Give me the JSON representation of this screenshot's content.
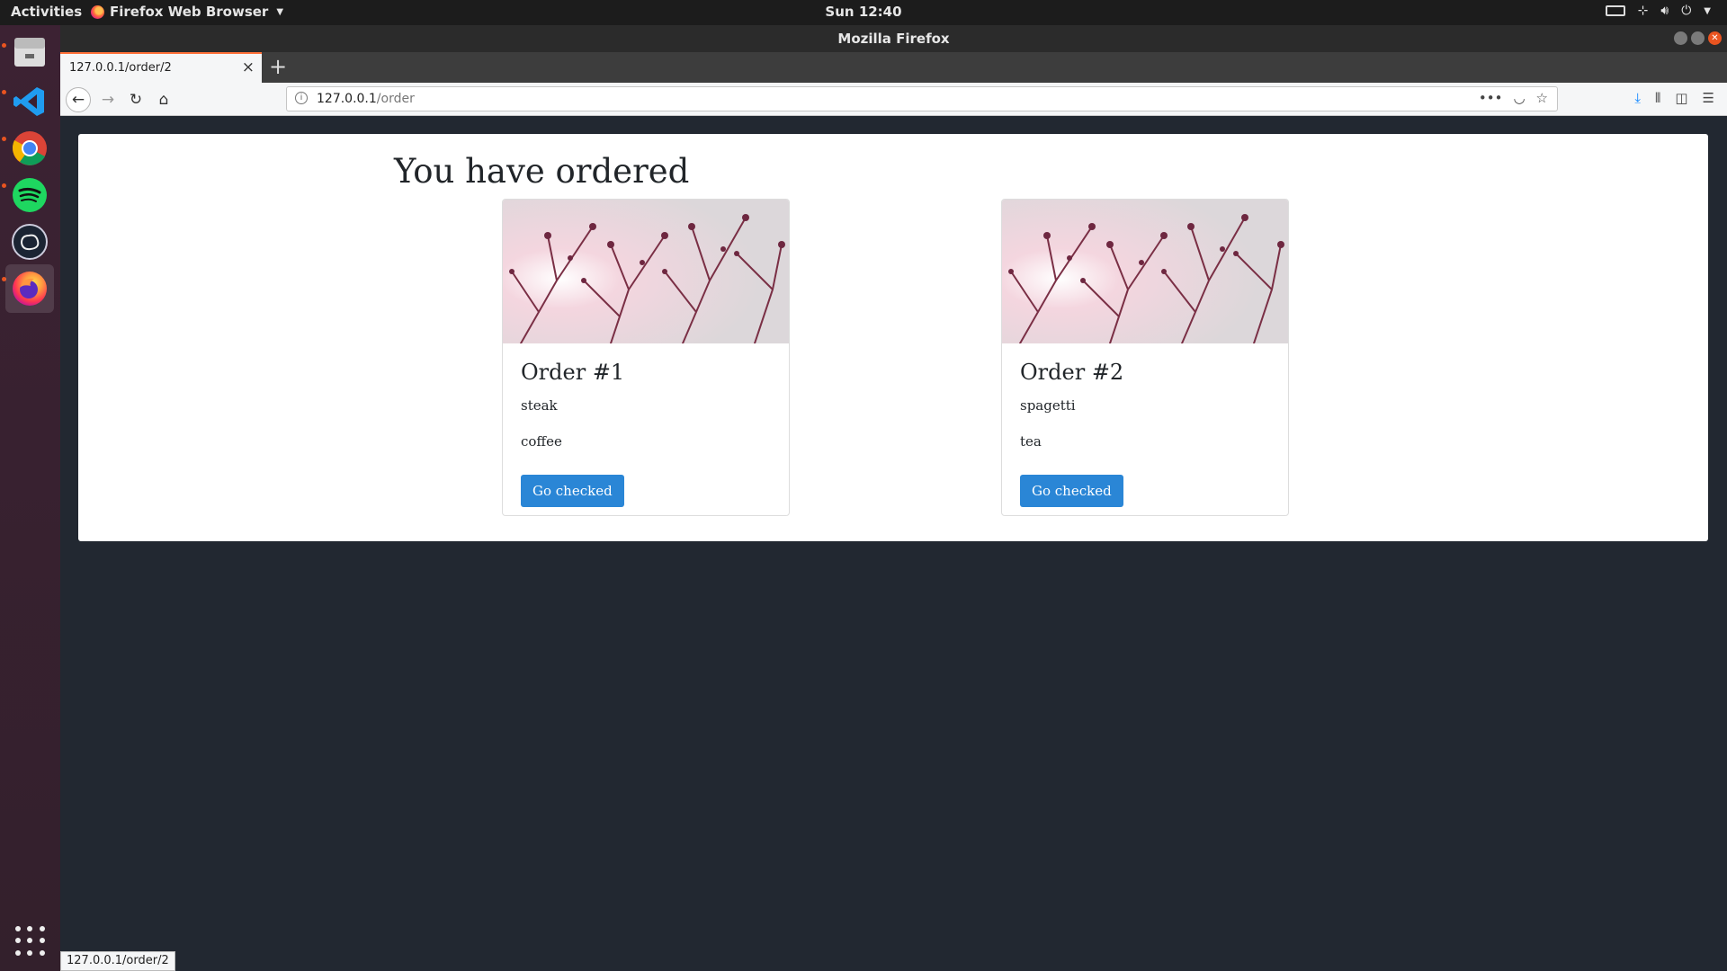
{
  "topbar": {
    "activities": "Activities",
    "app_menu": "Firefox Web Browser",
    "clock": "Sun 12:40"
  },
  "dock": {
    "items": [
      "files-icon",
      "vscode-icon",
      "chrome-icon",
      "spotify-icon",
      "kodi-icon",
      "firefox-icon"
    ]
  },
  "window": {
    "title": "Mozilla Firefox"
  },
  "tabs": [
    {
      "label": "127.0.0.1/order/2"
    }
  ],
  "url": {
    "host": "127.0.0.1",
    "path": "/order"
  },
  "page": {
    "heading": "You have ordered",
    "orders": [
      {
        "title": "Order #1",
        "items": [
          "steak",
          "coffee"
        ],
        "button": "Go checked"
      },
      {
        "title": "Order #2",
        "items": [
          "spagetti",
          "tea"
        ],
        "button": "Go checked"
      }
    ]
  },
  "status_bar": "127.0.0.1/order/2",
  "colors": {
    "button": "#2a86d6",
    "background": "#222831",
    "tab_accent": "#ff7139"
  }
}
